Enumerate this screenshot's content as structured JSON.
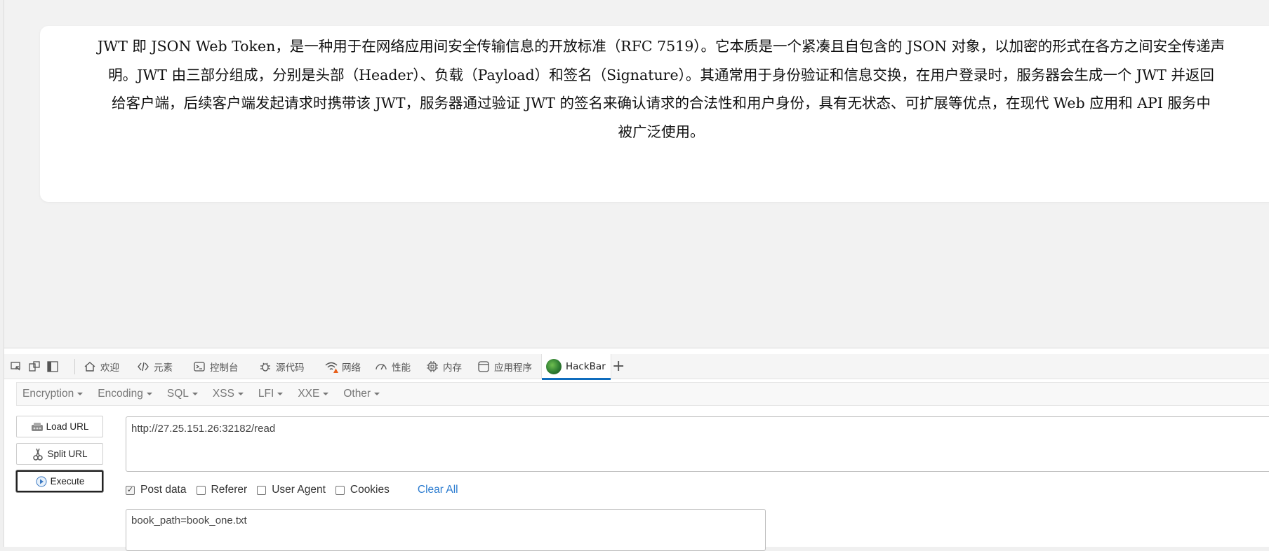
{
  "page": {
    "paragraph_lines": [
      "JWT 即 JSON Web Token，是一种用于在网络应用间安全传输信息的开放标准（RFC 7519）。它本质是一个紧凑且自包含的 JSON 对象，以加密的形式在各方之间安全传递声",
      "明。JWT 由三部分组成，分别是头部（Header）、负载（Payload）和签名（Signature）。其通常用于身份验证和信息交换，在用户登录时，服务器会生成一个 JWT 并返回",
      "给客户端，后续客户端发起请求时携带该 JWT，服务器通过验证 JWT 的签名来确认请求的合法性和用户身份，具有无状态、可扩展等优点，在现代 Web 应用和 API 服务中",
      "被广泛使用。"
    ]
  },
  "devtools": {
    "dock_icons": [
      "device-emulation-icon",
      "screencast-icon",
      "sidebar-toggle-icon"
    ],
    "tabs": [
      {
        "label": "欢迎",
        "icon": "home-icon"
      },
      {
        "label": "元素",
        "icon": "code-icon"
      },
      {
        "label": "控制台",
        "icon": "console-icon"
      },
      {
        "label": "源代码",
        "icon": "bug-icon"
      },
      {
        "label": "网络",
        "icon": "wifi-warning-icon"
      },
      {
        "label": "性能",
        "icon": "gauge-icon"
      },
      {
        "label": "内存",
        "icon": "chip-icon"
      },
      {
        "label": "应用程序",
        "icon": "app-icon"
      },
      {
        "label": "HackBar",
        "icon": "hackbar-logo-icon",
        "active": true
      }
    ],
    "add_tab_label": "+",
    "accent_color": "#0f6cbd"
  },
  "hackbar": {
    "menu": [
      "Encryption",
      "Encoding",
      "SQL",
      "XSS",
      "LFI",
      "XXE",
      "Other"
    ],
    "buttons": {
      "load_url": "Load URL",
      "split_url": "Split URL",
      "execute": "Execute"
    },
    "url": "http://27.25.151.26:32182/read",
    "options": {
      "post_data": {
        "label": "Post data",
        "checked": true
      },
      "referer": {
        "label": "Referer",
        "checked": false
      },
      "user_agent": {
        "label": "User Agent",
        "checked": false
      },
      "cookies": {
        "label": "Cookies",
        "checked": false
      }
    },
    "clear_all": "Clear All",
    "post_body": "book_path=book_one.txt",
    "link_color": "#2c7cd0"
  }
}
